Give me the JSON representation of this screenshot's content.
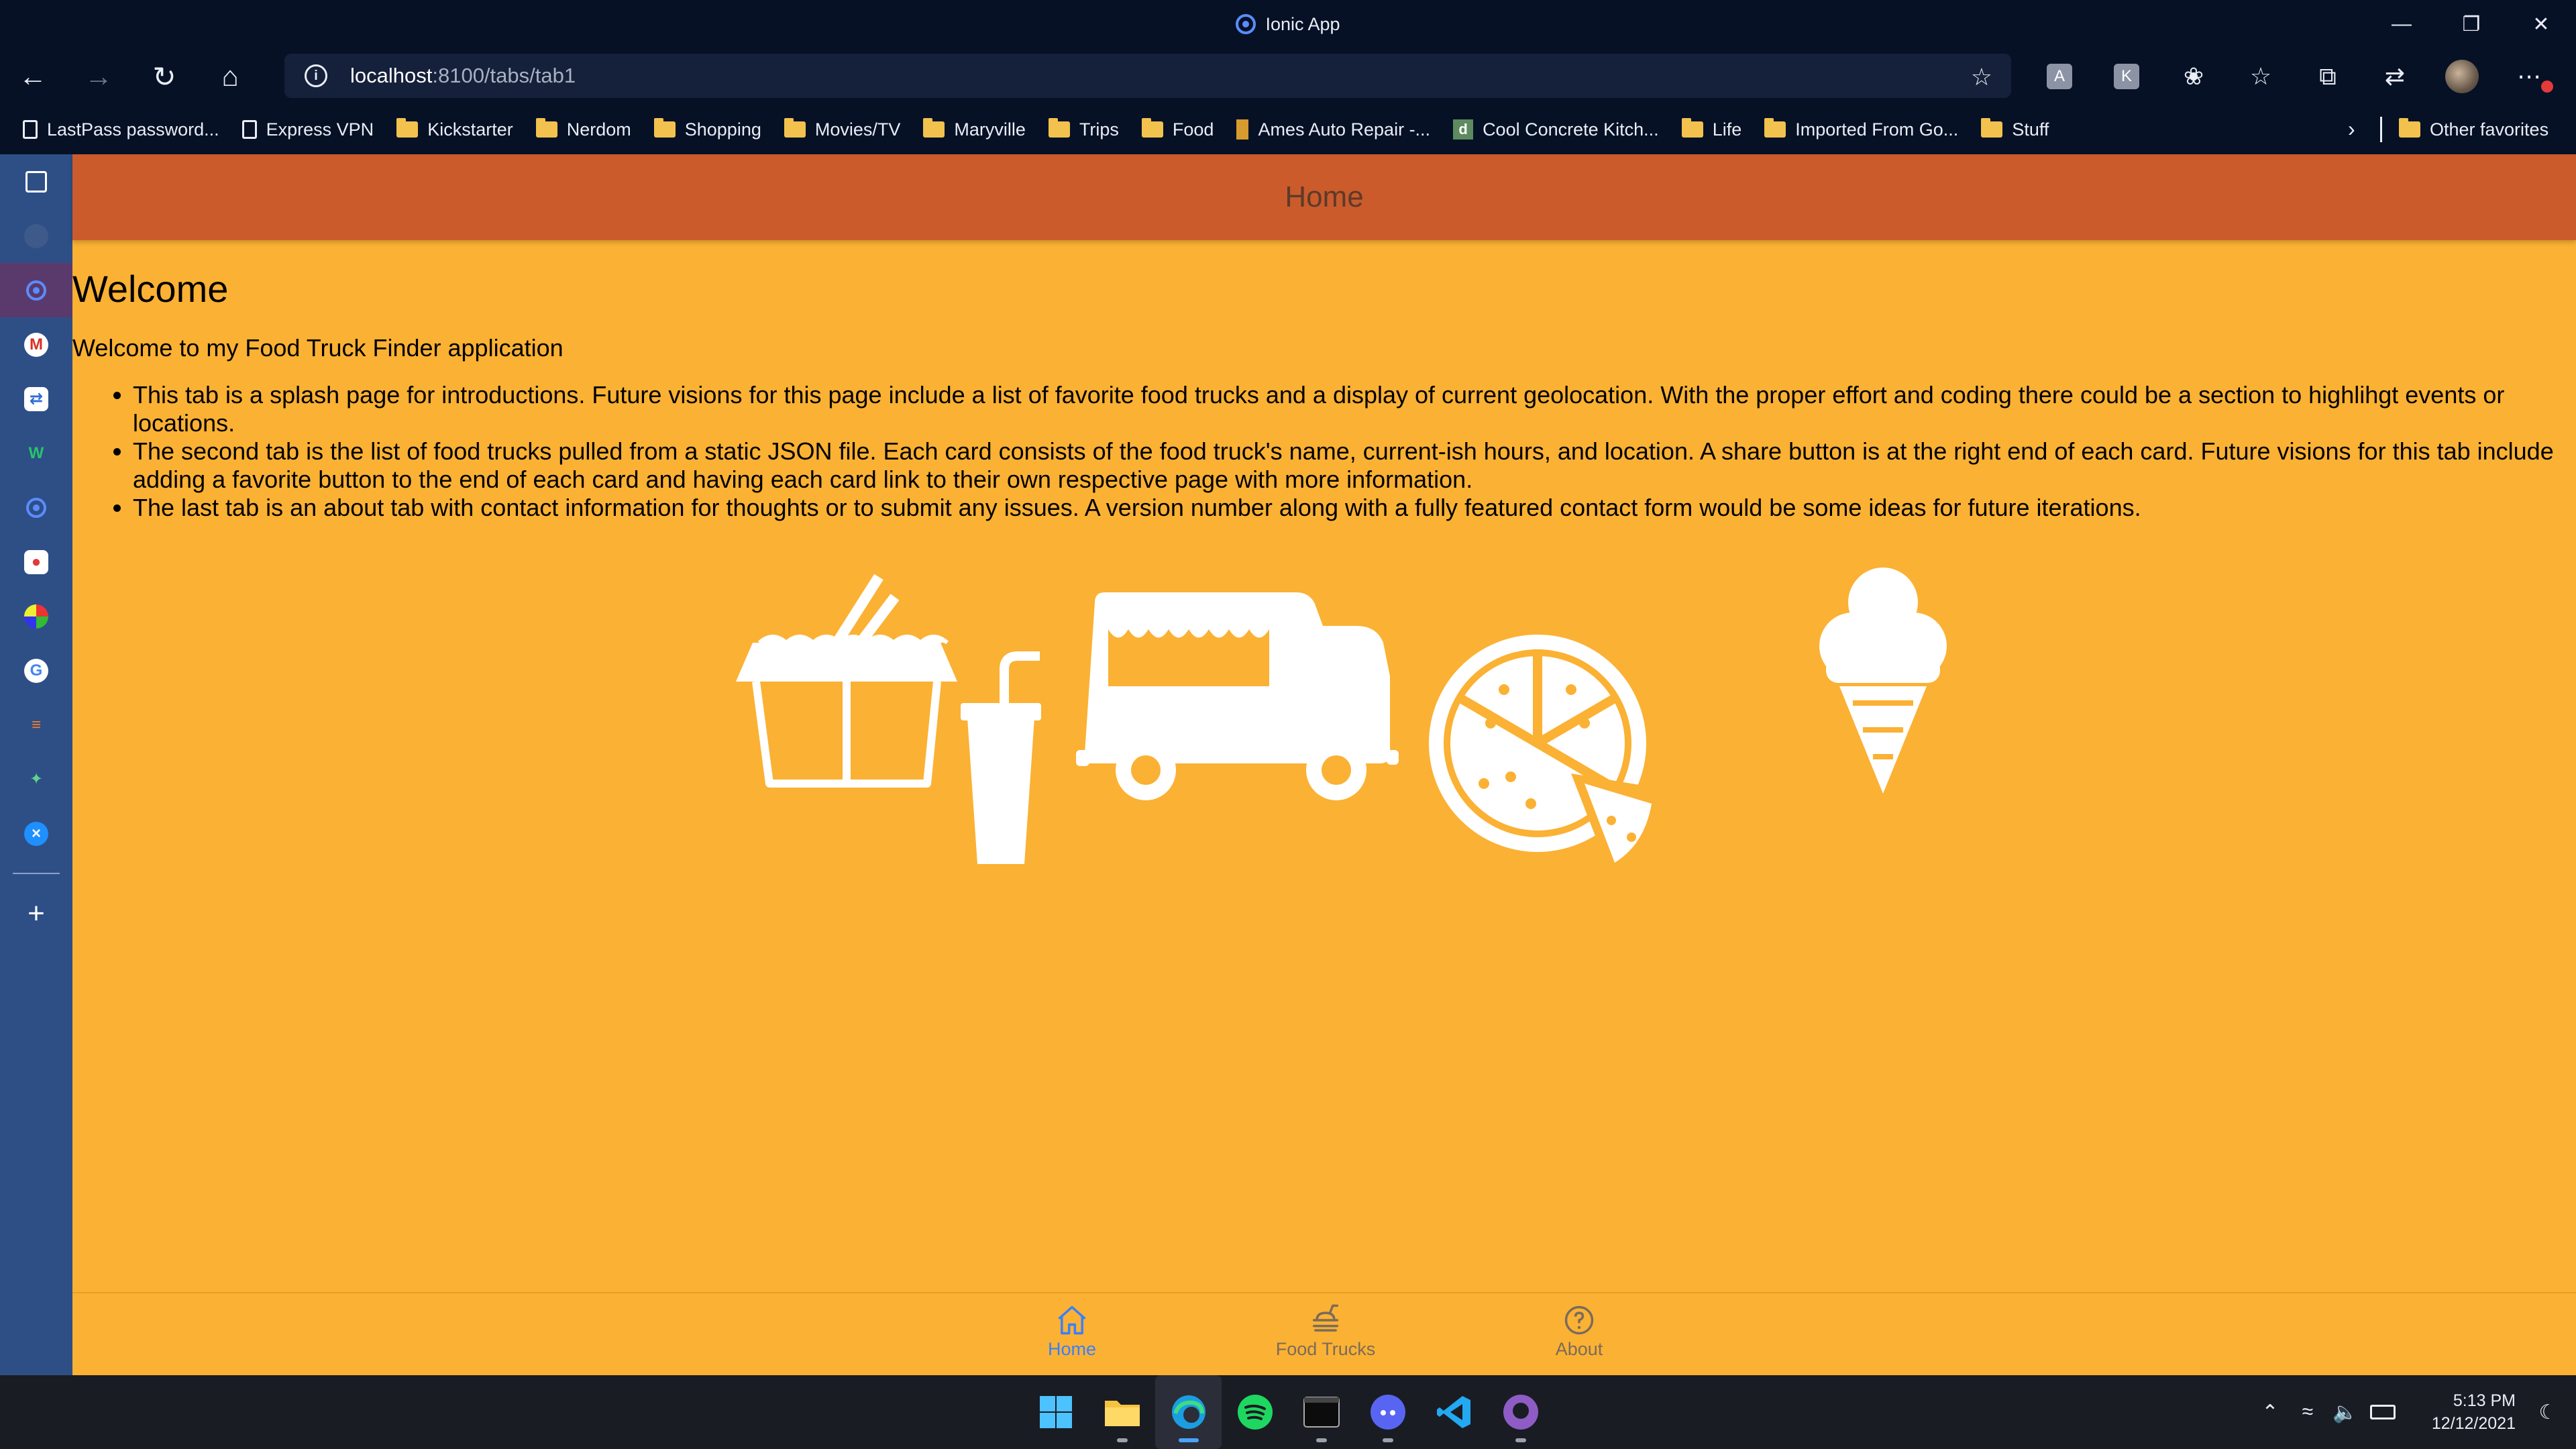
{
  "window": {
    "title": "Ionic App"
  },
  "browser": {
    "url_host": "localhost",
    "url_path": ":8100/tabs/tab1"
  },
  "bookmarks": [
    {
      "label": "LastPass password...",
      "icon": "document-icon"
    },
    {
      "label": "Express VPN",
      "icon": "document-icon"
    },
    {
      "label": "Kickstarter",
      "icon": "folder-icon"
    },
    {
      "label": "Nerdom",
      "icon": "folder-icon"
    },
    {
      "label": "Shopping",
      "icon": "folder-icon"
    },
    {
      "label": "Movies/TV",
      "icon": "folder-icon"
    },
    {
      "label": "Maryville",
      "icon": "folder-icon"
    },
    {
      "label": "Trips",
      "icon": "folder-icon"
    },
    {
      "label": "Food",
      "icon": "folder-icon"
    },
    {
      "label": "Ames Auto Repair -...",
      "icon": "site-icon"
    },
    {
      "label": "Cool Concrete Kitch...",
      "icon": "site-icon"
    },
    {
      "label": "Life",
      "icon": "folder-icon"
    },
    {
      "label": "Imported From Go...",
      "icon": "folder-icon"
    },
    {
      "label": "Stuff",
      "icon": "folder-icon"
    }
  ],
  "bookmarks_other": "Other favorites",
  "app": {
    "header_title": "Home",
    "welcome_heading": "Welcome",
    "intro": "Welcome to my Food Truck Finder application",
    "points": [
      "This tab is a splash page for introductions. Future visions for this page include a list of favorite food trucks and a display of current geolocation. With the proper effort and coding there could be a section to highlihgt events or locations.",
      "The second tab is the list of food trucks pulled from a static JSON file. Each card consists of the food truck's name, current-ish hours, and location. A share button is at the right end of each card. Future visions for this tab include adding a favorite button to the end of each card and having each card link to their own respective page with more information.",
      "The last tab is an about tab with contact information for thoughts or to submit any issues. A version number along with a fully featured contact form would be some ideas for future iterations."
    ],
    "tabs": [
      {
        "label": "Home",
        "icon": "home-icon",
        "active": true
      },
      {
        "label": "Food Trucks",
        "icon": "fast-food-icon",
        "active": false
      },
      {
        "label": "About",
        "icon": "help-circle-icon",
        "active": false
      }
    ]
  },
  "taskbar": {
    "time": "5:13 PM",
    "date": "12/12/2021"
  },
  "colors": {
    "app_background": "#fbb133",
    "header_background": "#cb5b2b",
    "active_tab": "#3880ff",
    "browser_chrome": "#061126",
    "edge_sidebar": "#2e4f86"
  }
}
